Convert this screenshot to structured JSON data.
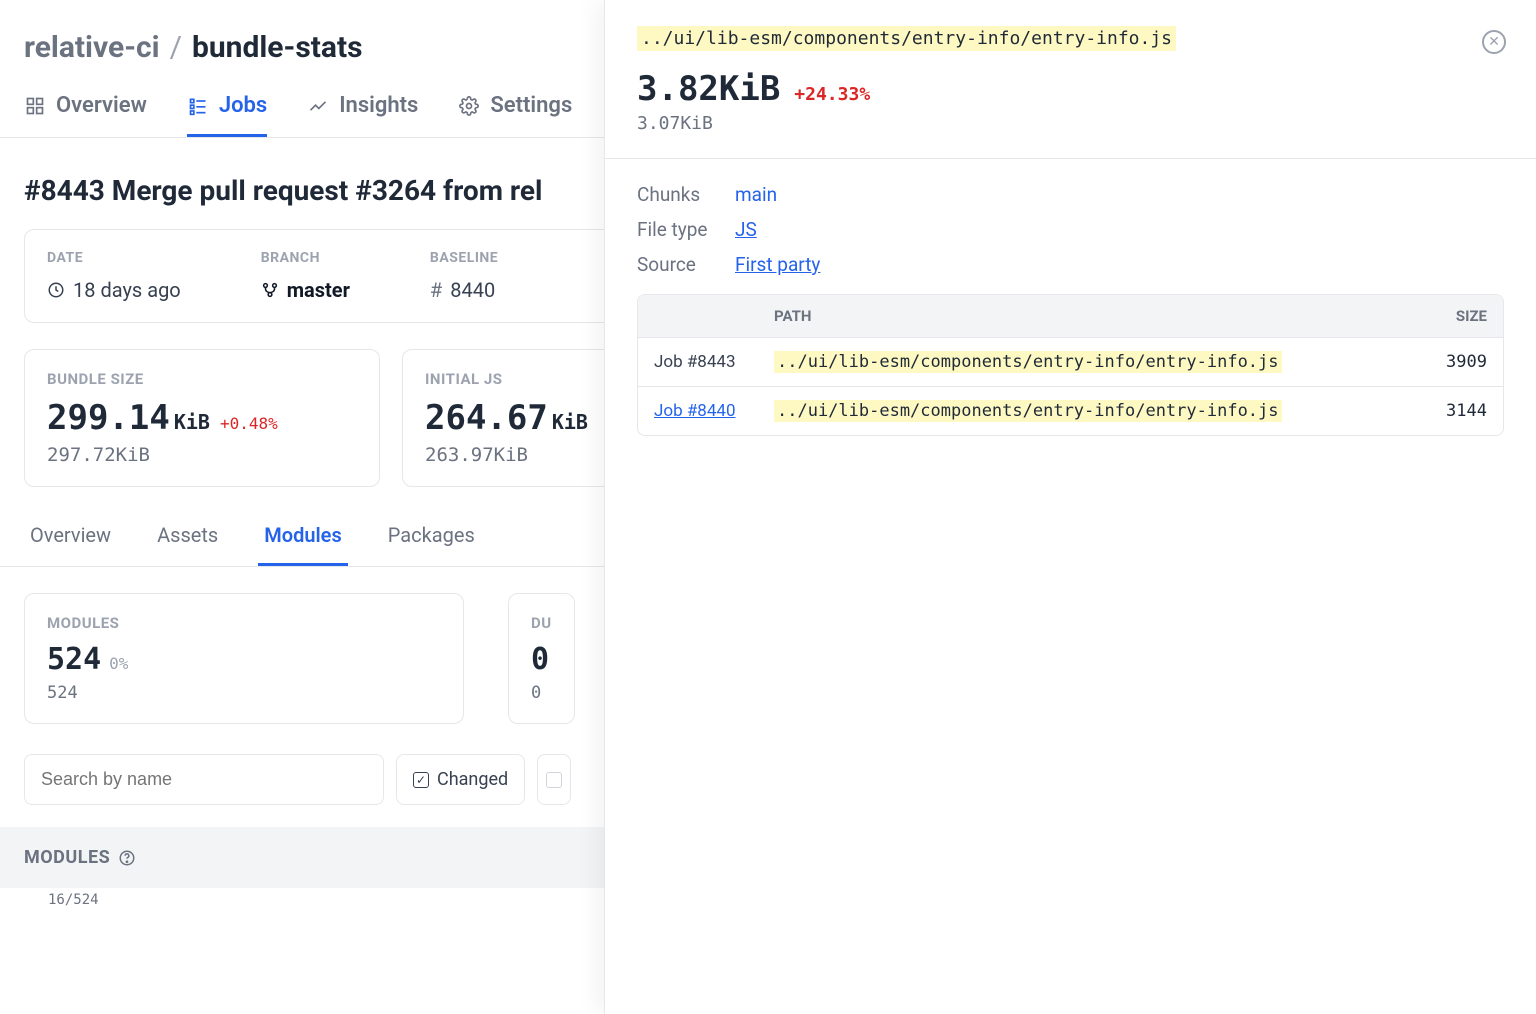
{
  "breadcrumb": {
    "org": "relative-ci",
    "sep": "/",
    "repo": "bundle-stats"
  },
  "tabs": {
    "overview": "Overview",
    "jobs": "Jobs",
    "insights": "Insights",
    "settings": "Settings"
  },
  "job_title": "#8443 Merge pull request #3264 from rel",
  "meta": {
    "date_label": "DATE",
    "date_value": "18 days ago",
    "branch_label": "BRANCH",
    "branch_value": "master",
    "baseline_label": "BASELINE",
    "baseline_value": "8440"
  },
  "stats": {
    "bundle": {
      "label": "BUNDLE SIZE",
      "value": "299.14",
      "unit": "KiB",
      "delta": "+0.48%",
      "prev": "297.72KiB"
    },
    "initialjs": {
      "label": "INITIAL JS",
      "value": "264.67",
      "unit": "KiB",
      "prev": "263.97KiB"
    }
  },
  "subtabs": {
    "overview": "Overview",
    "assets": "Assets",
    "modules": "Modules",
    "packages": "Packages"
  },
  "modules_card": {
    "label": "MODULES",
    "value": "524",
    "pct": "0%",
    "prev": "524"
  },
  "dup_card": {
    "label": "DU",
    "value": "0",
    "prev": "0"
  },
  "search_placeholder": "Search by name",
  "filter_changed": "Changed",
  "section_head": "MODULES",
  "section_sub": "16/524",
  "panel": {
    "path": "../ui/lib-esm/components/entry-info/entry-info.js",
    "size": "3.82KiB",
    "delta": "+24.33%",
    "prev": "3.07KiB",
    "kv": {
      "chunks_k": "Chunks",
      "chunks_v": "main",
      "filetype_k": "File type",
      "filetype_v": "JS",
      "source_k": "Source",
      "source_v": "First party"
    },
    "table": {
      "path_h": "PATH",
      "size_h": "SIZE",
      "rows": [
        {
          "job": "Job #8443",
          "is_link": false,
          "path": "../ui/lib-esm/components/entry-info/entry-info.js",
          "size": "3909"
        },
        {
          "job": "Job #8440",
          "is_link": true,
          "path": "../ui/lib-esm/components/entry-info/entry-info.js",
          "size": "3144"
        }
      ]
    }
  }
}
